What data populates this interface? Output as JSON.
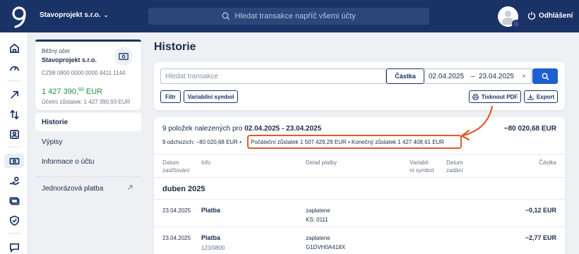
{
  "header": {
    "company": "Stavoprojekt s.r.o.",
    "search_placeholder": "Hledat transakce napříč všemi účty",
    "logout": "Odhlášení"
  },
  "account": {
    "type": "Běžný účet",
    "name": "Stavoprojekt s.r.o.",
    "number": "CZ98 0800 0000 0000 4411 1144",
    "balance_main": "1 427 390,",
    "balance_cents": "93",
    "balance_currency": " EUR",
    "accounting_balance": "Účetní zůstatek: 1 427 390,93 EUR"
  },
  "menu": {
    "items": [
      "Historie",
      "Výpisy",
      "Informace o účtu"
    ],
    "single_payment": "Jednorázová platba"
  },
  "main": {
    "title": "Historie",
    "search_placeholder": "Hledat transakce",
    "castka": "Částka",
    "date_from": "02.04.2025",
    "date_sep": "–",
    "date_to": "23.04.2025",
    "clear": "×",
    "chips": {
      "filter": "Filtr",
      "var_symbol": "Variabilní symbol",
      "print": "Tisknout PDF",
      "export": "Export"
    }
  },
  "results": {
    "summary_prefix": "9 položek nalezených pro ",
    "summary_range": "02.04.2025 - 23.04.2025",
    "total": "−80 020,68 EUR",
    "outgoing": "9 odchozích: −80 020,68 EUR •",
    "balances": "Počáteční zůstatek 1 507 429,29 EUR • Konečný zůstatek 1 427 408,61 EUR",
    "columns": {
      "date_line1": "Datum",
      "date_line2": "zaúčtování",
      "info": "Info",
      "detail": "Detail platby",
      "vs_line1": "Variabil-",
      "vs_line2": "ní symbol",
      "entered_line1": "Datum",
      "entered_line2": "zadání",
      "amount": "Částka"
    },
    "month": "duben 2025",
    "rows": [
      {
        "date": "23.04.2025",
        "info": "Platba",
        "info2": "",
        "detail1": "zaplatene",
        "detail2": "KS: 0111",
        "amount": "−0,12 EUR"
      },
      {
        "date": "23.04.2025",
        "info": "Platba",
        "info2": "123/0800",
        "detail1": "zaplatene",
        "detail2": "G1DVH0A418X",
        "amount": "−2,77 EUR"
      }
    ]
  },
  "colors": {
    "header_bg": "#1a3366",
    "accent_blue": "#1d5fd1",
    "balance_green": "#1e8f3a",
    "highlight_orange": "#e05a2a"
  }
}
